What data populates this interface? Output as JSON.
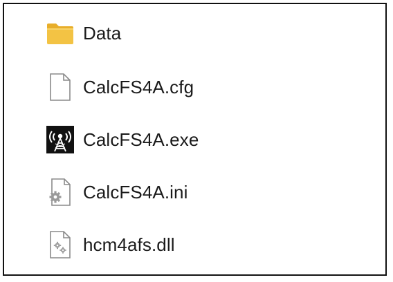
{
  "files": [
    {
      "name": "Data",
      "icon": "folder-icon",
      "type": "folder"
    },
    {
      "name": "CalcFS4A.cfg",
      "icon": "blank-file-icon",
      "type": "file"
    },
    {
      "name": "CalcFS4A.exe",
      "icon": "antenna-app-icon",
      "type": "application"
    },
    {
      "name": "CalcFS4A.ini",
      "icon": "settings-file-icon",
      "type": "file"
    },
    {
      "name": "hcm4afs.dll",
      "icon": "dll-file-icon",
      "type": "file"
    }
  ],
  "colors": {
    "folder_main": "#F3C344",
    "folder_tab": "#E8AE2A",
    "page_outline": "#8A8A8A",
    "app_background": "#111111"
  }
}
